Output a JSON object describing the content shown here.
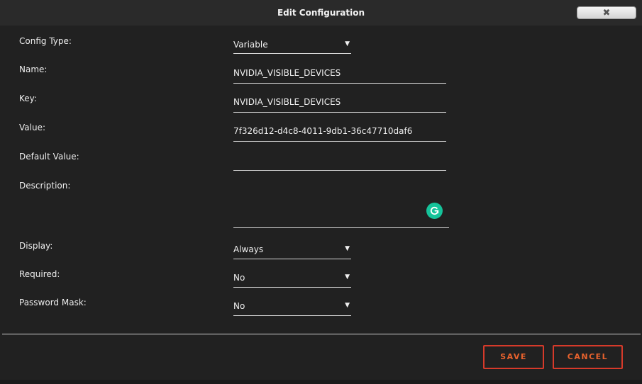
{
  "dialog": {
    "title": "Edit Configuration",
    "close_icon": "close-icon"
  },
  "form": {
    "config_type": {
      "label": "Config Type:",
      "value": "Variable"
    },
    "name": {
      "label": "Name:",
      "value": "NVIDIA_VISIBLE_DEVICES"
    },
    "key": {
      "label": "Key:",
      "value": "NVIDIA_VISIBLE_DEVICES"
    },
    "value": {
      "label": "Value:",
      "value": "7f326d12-d4c8-4011-9db1-36c47710daf6"
    },
    "default_value": {
      "label": "Default Value:",
      "value": ""
    },
    "description": {
      "label": "Description:",
      "value": ""
    },
    "display": {
      "label": "Display:",
      "value": "Always"
    },
    "required": {
      "label": "Required:",
      "value": "No"
    },
    "password_mask": {
      "label": "Password Mask:",
      "value": "No"
    }
  },
  "buttons": {
    "save": "SAVE",
    "cancel": "CANCEL"
  },
  "colors": {
    "accent": "#e8622d",
    "border_accent": "#d63a2a",
    "grammarly": "#15c39a"
  }
}
